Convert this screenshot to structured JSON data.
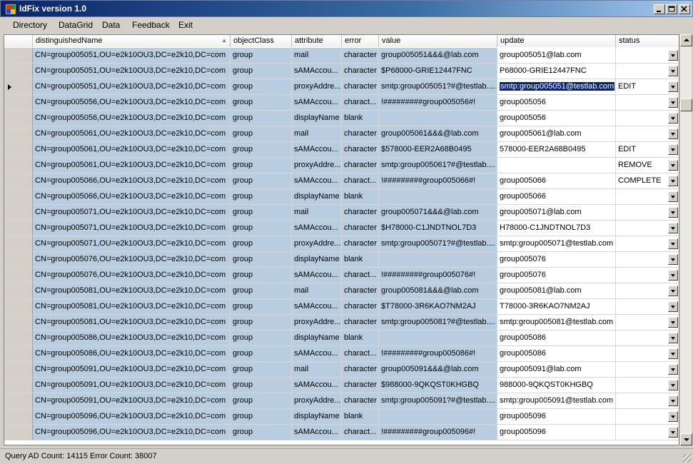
{
  "window": {
    "title": "IdFix version 1.0"
  },
  "menu": [
    "Directory",
    "DataGrid",
    "Data",
    "Feedback",
    "Exit"
  ],
  "grid": {
    "columns": [
      "distinguishedName",
      "objectClass",
      "attribute",
      "error",
      "value",
      "update",
      "status"
    ],
    "rows": [
      [
        "CN=group005051,OU=e2k10OU3,DC=e2k10,DC=com",
        "group",
        "mail",
        "character",
        "group005051&&&@lab.com",
        "group005051@lab.com",
        ""
      ],
      [
        "CN=group005051,OU=e2k10OU3,DC=e2k10,DC=com",
        "group",
        "sAMAccou...",
        "character",
        "$P68000-GRIE12447FNC",
        "P68000-GRIE12447FNC",
        ""
      ],
      [
        "CN=group005051,OU=e2k10OU3,DC=e2k10,DC=com",
        "group",
        "proxyAddre...",
        "character",
        "smtp:group005051?#@testlab....",
        "smtp:group005051@testlab.com",
        "EDIT"
      ],
      [
        "CN=group005056,OU=e2k10OU3,DC=e2k10,DC=com",
        "group",
        "sAMAccou...",
        "charact...",
        "!#########group005056#!",
        "group005056",
        ""
      ],
      [
        "CN=group005056,OU=e2k10OU3,DC=e2k10,DC=com",
        "group",
        "displayName",
        "blank",
        "",
        "group005056",
        ""
      ],
      [
        "CN=group005061,OU=e2k10OU3,DC=e2k10,DC=com",
        "group",
        "mail",
        "character",
        "group005061&&&@lab.com",
        "group005061@lab.com",
        ""
      ],
      [
        "CN=group005061,OU=e2k10OU3,DC=e2k10,DC=com",
        "group",
        "sAMAccou...",
        "character",
        "$578000-EER2A68B0495",
        "578000-EER2A68B0495",
        "EDIT"
      ],
      [
        "CN=group005061,OU=e2k10OU3,DC=e2k10,DC=com",
        "group",
        "proxyAddre...",
        "character",
        "smtp:group005061?#@testlab....",
        "",
        "REMOVE"
      ],
      [
        "CN=group005066,OU=e2k10OU3,DC=e2k10,DC=com",
        "group",
        "sAMAccou...",
        "charact...",
        "!#########group005066#!",
        "group005066",
        "COMPLETE"
      ],
      [
        "CN=group005066,OU=e2k10OU3,DC=e2k10,DC=com",
        "group",
        "displayName",
        "blank",
        "",
        "group005066",
        ""
      ],
      [
        "CN=group005071,OU=e2k10OU3,DC=e2k10,DC=com",
        "group",
        "mail",
        "character",
        "group005071&&&@lab.com",
        "group005071@lab.com",
        ""
      ],
      [
        "CN=group005071,OU=e2k10OU3,DC=e2k10,DC=com",
        "group",
        "sAMAccou...",
        "character",
        "$H78000-C1JNDTNOL7D3",
        "H78000-C1JNDTNOL7D3",
        ""
      ],
      [
        "CN=group005071,OU=e2k10OU3,DC=e2k10,DC=com",
        "group",
        "proxyAddre...",
        "character",
        "smtp:group005071?#@testlab....",
        "smtp:group005071@testlab.com",
        ""
      ],
      [
        "CN=group005076,OU=e2k10OU3,DC=e2k10,DC=com",
        "group",
        "displayName",
        "blank",
        "",
        "group005076",
        ""
      ],
      [
        "CN=group005076,OU=e2k10OU3,DC=e2k10,DC=com",
        "group",
        "sAMAccou...",
        "charact...",
        "!#########group005076#!",
        "group005076",
        ""
      ],
      [
        "CN=group005081,OU=e2k10OU3,DC=e2k10,DC=com",
        "group",
        "mail",
        "character",
        "group005081&&&@lab.com",
        "group005081@lab.com",
        ""
      ],
      [
        "CN=group005081,OU=e2k10OU3,DC=e2k10,DC=com",
        "group",
        "sAMAccou...",
        "character",
        "$T78000-3R6KAO7NM2AJ",
        "T78000-3R6KAO7NM2AJ",
        ""
      ],
      [
        "CN=group005081,OU=e2k10OU3,DC=e2k10,DC=com",
        "group",
        "proxyAddre...",
        "character",
        "smtp:group005081?#@testlab....",
        "smtp:group005081@testlab.com",
        ""
      ],
      [
        "CN=group005086,OU=e2k10OU3,DC=e2k10,DC=com",
        "group",
        "displayName",
        "blank",
        "",
        "group005086",
        ""
      ],
      [
        "CN=group005086,OU=e2k10OU3,DC=e2k10,DC=com",
        "group",
        "sAMAccou...",
        "charact...",
        "!#########group005086#!",
        "group005086",
        ""
      ],
      [
        "CN=group005091,OU=e2k10OU3,DC=e2k10,DC=com",
        "group",
        "mail",
        "character",
        "group005091&&&@lab.com",
        "group005091@lab.com",
        ""
      ],
      [
        "CN=group005091,OU=e2k10OU3,DC=e2k10,DC=com",
        "group",
        "sAMAccou...",
        "character",
        "$988000-9QKQST0KHGBQ",
        "988000-9QKQST0KHGBQ",
        ""
      ],
      [
        "CN=group005091,OU=e2k10OU3,DC=e2k10,DC=com",
        "group",
        "proxyAddre...",
        "character",
        "smtp:group005091?#@testlab....",
        "smtp:group005091@testlab.com",
        ""
      ],
      [
        "CN=group005096,OU=e2k10OU3,DC=e2k10,DC=com",
        "group",
        "displayName",
        "blank",
        "",
        "group005096",
        ""
      ],
      [
        "CN=group005096,OU=e2k10OU3,DC=e2k10,DC=com",
        "group",
        "sAMAccou...",
        "charact...",
        "!#########group005096#!",
        "group005096",
        ""
      ]
    ],
    "current_row": 2
  },
  "statusbar": {
    "text": "Query AD Count: 14115  Error Count: 38007"
  }
}
